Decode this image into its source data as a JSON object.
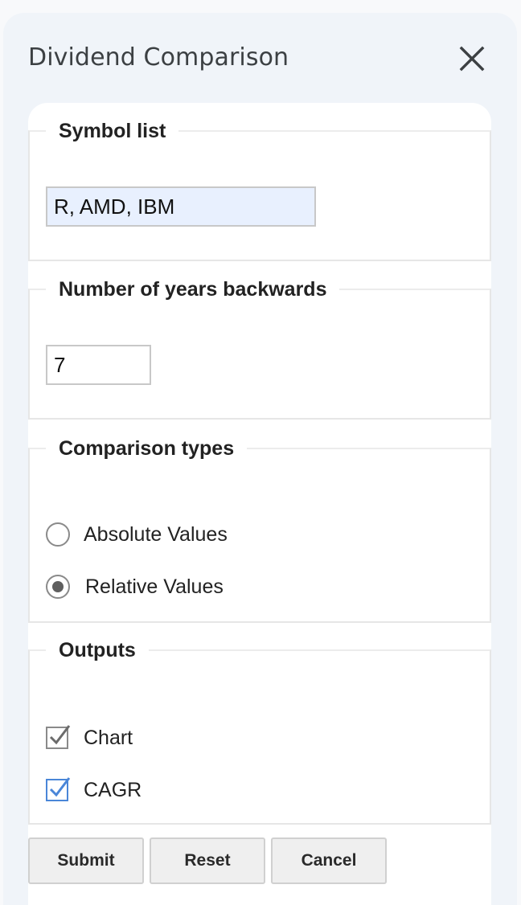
{
  "dialog": {
    "title": "Dividend Comparison",
    "close_icon": "close-icon"
  },
  "symbol_list": {
    "legend": "Symbol list",
    "value": "R, AMD, IBM"
  },
  "years": {
    "legend": "Number of years backwards",
    "value": "7"
  },
  "comparison_types": {
    "legend": "Comparison types",
    "options": [
      {
        "label": "Absolute Values",
        "selected": false
      },
      {
        "label": "Relative Values",
        "selected": true
      }
    ]
  },
  "outputs": {
    "legend": "Outputs",
    "options": [
      {
        "label": "Chart",
        "checked": true
      },
      {
        "label": "CAGR",
        "checked": true
      }
    ]
  },
  "buttons": {
    "submit": "Submit",
    "reset": "Reset",
    "cancel": "Cancel"
  },
  "colors": {
    "dialog_bg": "#f0f4f9",
    "input_highlight": "#e8f0fe",
    "checkbox_accent": "#4a86d8"
  }
}
